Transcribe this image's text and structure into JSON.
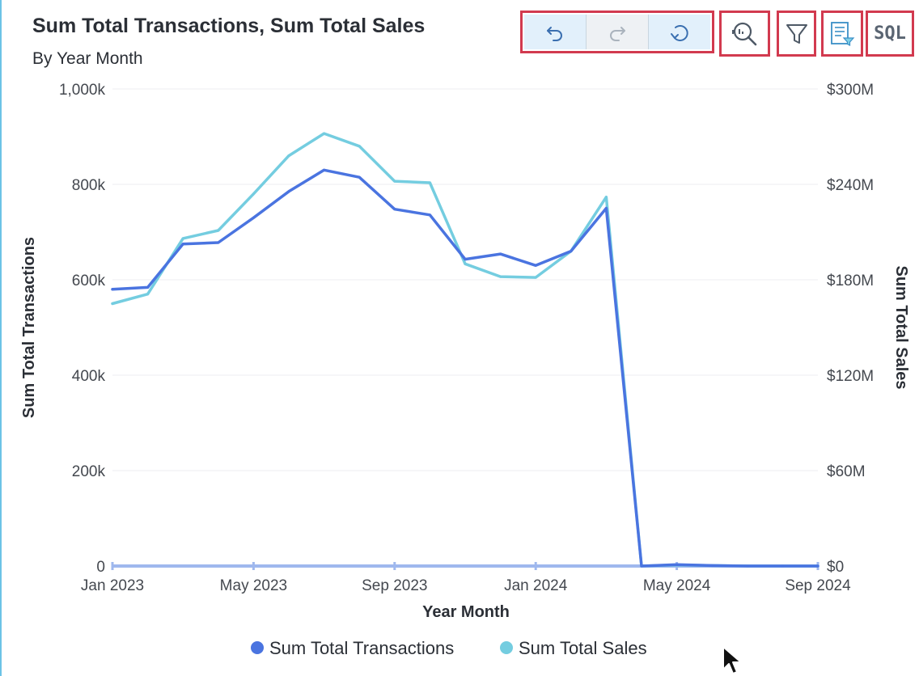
{
  "header": {
    "title": "Sum Total Transactions, Sum Total Sales",
    "subtitle": "By Year Month"
  },
  "toolbar": {
    "undo_icon": "undo-icon",
    "redo_icon": "redo-icon",
    "reset_icon": "reset-icon",
    "zoom_icon": "zoom-search-icon",
    "filter_icon": "filter-icon",
    "filter_list_icon": "filter-list-icon",
    "sql_label": "SQL"
  },
  "colors": {
    "transactions": "#4a74e0",
    "sales": "#74cde0",
    "highlight": "#d23a4f"
  },
  "chart_data": {
    "type": "line",
    "title": "Sum Total Transactions, Sum Total Sales",
    "subtitle": "By Year Month",
    "xlabel": "Year Month",
    "ylabel_left": "Sum Total Transactions",
    "ylabel_right": "Sum Total Sales",
    "x_ticks": [
      "Jan 2023",
      "May 2023",
      "Sep 2023",
      "Jan 2024",
      "May 2024",
      "Sep 2024"
    ],
    "y_left_ticks": [
      "0",
      "200k",
      "400k",
      "600k",
      "800k",
      "1,000k"
    ],
    "y_right_ticks": [
      "$0",
      "$60M",
      "$120M",
      "$180M",
      "$240M",
      "$300M"
    ],
    "ylim_left": [
      0,
      1000000
    ],
    "ylim_right": [
      0,
      300000000
    ],
    "x": [
      "2023-01",
      "2023-02",
      "2023-03",
      "2023-04",
      "2023-05",
      "2023-06",
      "2023-07",
      "2023-08",
      "2023-09",
      "2023-10",
      "2023-11",
      "2023-12",
      "2024-01",
      "2024-02",
      "2024-03",
      "2024-04",
      "2024-05",
      "2024-06",
      "2024-07",
      "2024-08",
      "2024-09"
    ],
    "series": [
      {
        "name": "Sum Total Transactions",
        "axis": "left",
        "values": [
          580000,
          584000,
          675000,
          678000,
          730000,
          785000,
          830000,
          815000,
          748000,
          736000,
          643000,
          654000,
          630000,
          660000,
          750000,
          0,
          3000,
          1000,
          0,
          0,
          0
        ]
      },
      {
        "name": "Sum Total Sales",
        "axis": "right",
        "values": [
          165000000,
          171000000,
          206000000,
          211000000,
          234000000,
          258000000,
          272000000,
          264000000,
          242000000,
          241000000,
          190000000,
          182000000,
          181500000,
          198000000,
          232000000,
          0,
          600000,
          300000,
          0,
          0,
          0
        ]
      }
    ],
    "legend": {
      "placement": "bottom",
      "entries": [
        "Sum Total Transactions",
        "Sum Total Sales"
      ]
    },
    "grid": true
  }
}
